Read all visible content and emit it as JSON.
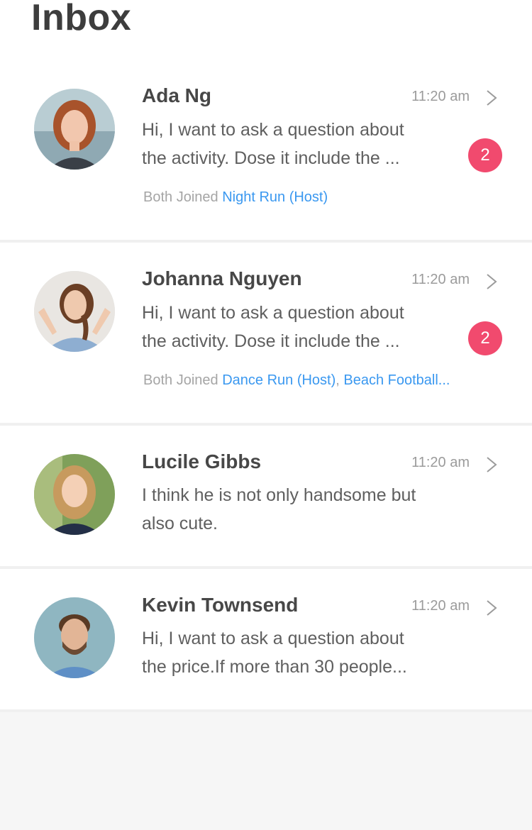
{
  "header": {
    "title": "Inbox"
  },
  "colors": {
    "badge": "#f14a6e",
    "link": "#3a98f0",
    "time": "#9b9b9b"
  },
  "threads": [
    {
      "name": "Ada Ng",
      "time": "11:20 am",
      "preview_line1": "Hi, I want to ask a question about",
      "preview_line2": "the activity. Dose it include the ...",
      "unread": "2",
      "joined_prefix": "Both Joined",
      "activities": [
        "Night Run (Host)"
      ],
      "chevron_icon": "chevron-right-icon"
    },
    {
      "name": "Johanna Nguyen",
      "time": "11:20 am",
      "preview_line1": "Hi, I want to ask a question about",
      "preview_line2": "the activity. Dose it include the ...",
      "unread": "2",
      "joined_prefix": "Both Joined",
      "activities": [
        "Dance Run (Host)",
        "Beach Football..."
      ],
      "activity_separator": ",",
      "chevron_icon": "chevron-right-icon"
    },
    {
      "name": "Lucile Gibbs",
      "time": "11:20 am",
      "preview_line1": "I think he is not only handsome but",
      "preview_line2": "also cute.",
      "chevron_icon": "chevron-right-icon"
    },
    {
      "name": "Kevin Townsend",
      "time": "11:20 am",
      "preview_line1": "Hi, I want to ask a question about",
      "preview_line2": "the price.If more than 30 people...",
      "chevron_icon": "chevron-right-icon"
    }
  ]
}
